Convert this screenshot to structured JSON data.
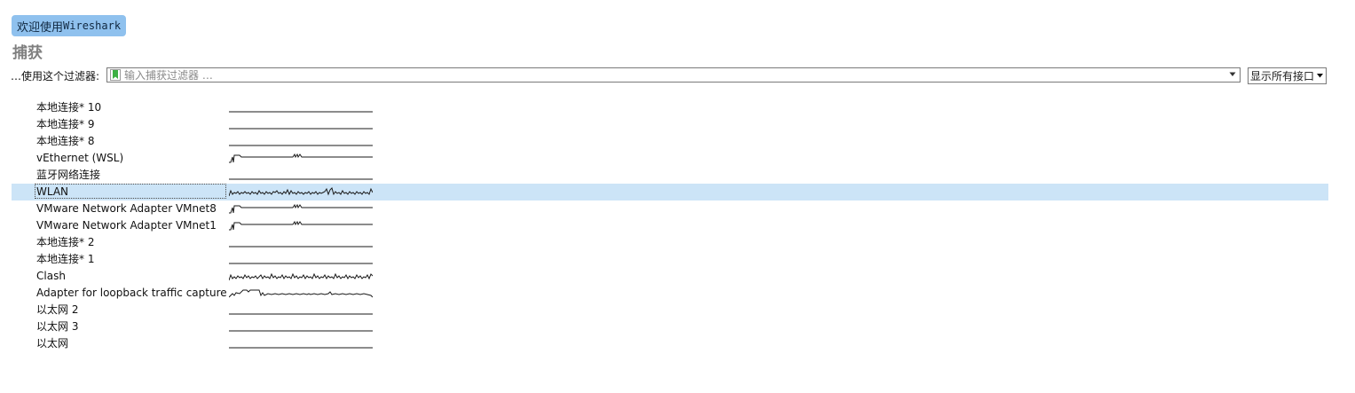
{
  "welcome": {
    "prefix": "欢迎使用 ",
    "app_name": "Wireshark"
  },
  "capture": {
    "title": "捕获",
    "filter_label": "…使用这个过滤器:",
    "filter_placeholder": "输入捕获过滤器 …",
    "interfaces_dropdown": "显示所有接口"
  },
  "interfaces": [
    {
      "name": "本地连接* 10",
      "traffic": "flat"
    },
    {
      "name": "本地连接* 9",
      "traffic": "flat"
    },
    {
      "name": "本地连接* 8",
      "traffic": "flat"
    },
    {
      "name": "vEthernet (WSL)",
      "traffic": "spike"
    },
    {
      "name": "蓝牙网络连接",
      "traffic": "flat"
    },
    {
      "name": "WLAN",
      "traffic": "busy",
      "selected": true
    },
    {
      "name": "VMware Network Adapter VMnet8",
      "traffic": "spike"
    },
    {
      "name": "VMware Network Adapter VMnet1",
      "traffic": "spike"
    },
    {
      "name": "本地连接* 2",
      "traffic": "flat"
    },
    {
      "name": "本地连接* 1",
      "traffic": "flat"
    },
    {
      "name": "Clash",
      "traffic": "busy"
    },
    {
      "name": "Adapter for loopback traffic capture",
      "traffic": "loopback"
    },
    {
      "name": "以太网 2",
      "traffic": "flat"
    },
    {
      "name": "以太网 3",
      "traffic": "flat"
    },
    {
      "name": "以太网",
      "traffic": "flat"
    }
  ],
  "colors": {
    "welcome_bg": "#8fc1ee",
    "selection": "#cce4f7",
    "bookmark_green": "#3cb043"
  }
}
